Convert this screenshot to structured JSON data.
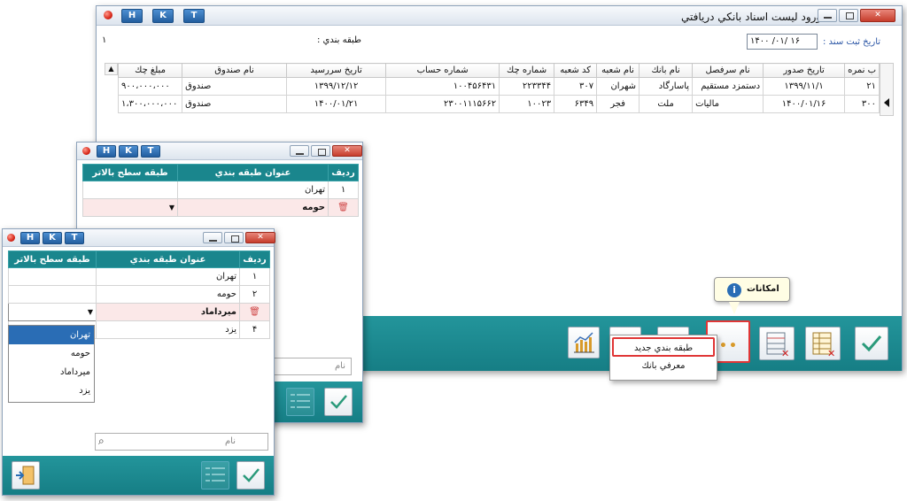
{
  "main_window": {
    "title": "ورود ليست اسناد بانكي دريافتي",
    "hkt": [
      "H",
      "K",
      "T"
    ],
    "reg_date_label": "تاريخ ثبت سند :",
    "reg_date_value": "۱۴۰۰ /۰۱/ ۱۶",
    "category_label": "طبقه بندي :",
    "left_number": "۱",
    "columns": [
      "ب نمره",
      "تاريخ صدور",
      "نام سرفصل",
      "نام بانك",
      "نام شعبه",
      "كد شعبه",
      "شماره چك",
      "شماره حساب",
      "تاريخ سررسيد",
      "نام صندوق",
      "مبلغ چك"
    ],
    "rows": [
      [
        "۲۱",
        "۱۳۹۹/۱۱/۱",
        "دستمزد مستقيم",
        "پاسارگاد",
        "شهران",
        "۳۰۷",
        "۲۲۳۳۴۴",
        "۱۰۰۴۵۶۴۳۱",
        "۱۳۹۹/۱۲/۱۲",
        "صندوق",
        "۹۰۰،۰۰۰،۰۰۰"
      ],
      [
        "۳۰۰",
        "۱۴۰۰/۰۱/۱۶",
        "ماليات",
        "ملت",
        "فجر",
        "۶۳۴۹",
        "۱۰۰۲۳",
        "۲۳۰۰۱۱۱۵۶۶۲",
        "۱۴۰۰/۰۱/۲۱",
        "صندوق",
        "۱،۳۰۰،۰۰۰،۰۰۰"
      ]
    ],
    "tooltip": "امكانات",
    "popup_menu": [
      "طبقه بندي جديد",
      "معرفي بانك"
    ]
  },
  "mid_window": {
    "hkt": [
      "H",
      "K",
      "T"
    ],
    "columns": [
      "رديف",
      "عنوان طبقه بندي",
      "طبقه سطح بالاتر"
    ],
    "rows": [
      {
        "num": "۱",
        "title": "تهران",
        "parent": ""
      },
      {
        "num": "",
        "title": "حومه",
        "parent": ""
      }
    ],
    "search_placeholder": "نام"
  },
  "front_window": {
    "hkt": [
      "H",
      "K",
      "T"
    ],
    "columns": [
      "رديف",
      "عنوان طبقه بندي",
      "طبقه سطح بالاتر"
    ],
    "rows": [
      {
        "num": "۱",
        "title": "تهران",
        "parent": ""
      },
      {
        "num": "۲",
        "title": "حومه",
        "parent": ""
      },
      {
        "num": "",
        "title": "ميرداماد",
        "parent": ""
      },
      {
        "num": "۴",
        "title": "يزد",
        "parent": ""
      }
    ],
    "dropdown_options": [
      "تهران",
      "حومه",
      "ميرداماد",
      "يزد"
    ],
    "search_placeholder": "نام"
  },
  "colors": {
    "teal": "#1a868d",
    "accent_blue": "#2a6db5",
    "close_red": "#d0473a",
    "selection_red": "#e03636",
    "pink_row": "#fbe8e8"
  },
  "icons": [
    "chart-icon",
    "info-icon",
    "delete-icon",
    "check-icon",
    "list-icon",
    "exit-icon",
    "search-icon",
    "dropdown-arrow-icon"
  ]
}
